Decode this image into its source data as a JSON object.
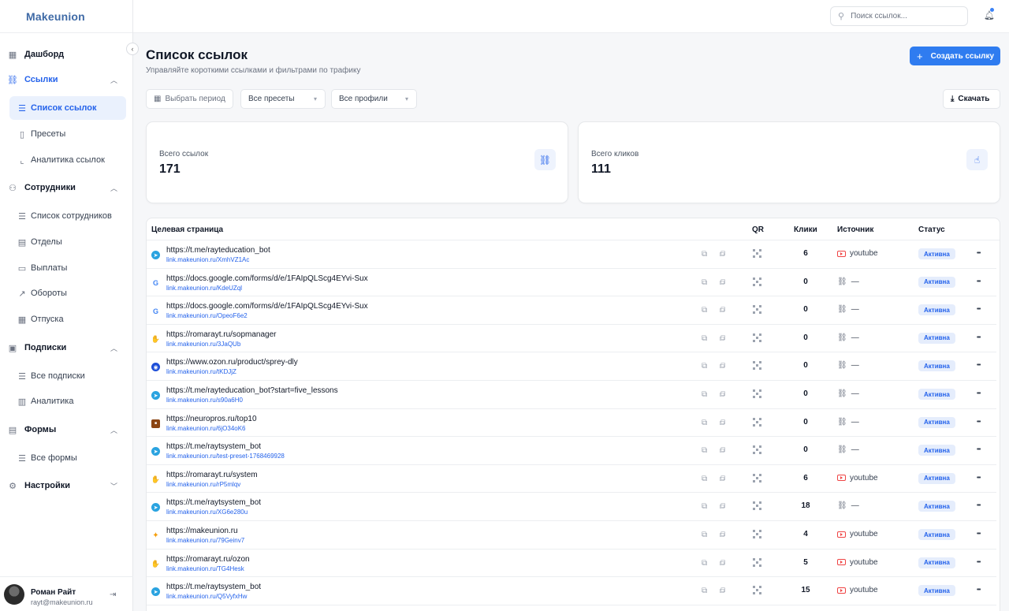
{
  "app": {
    "logo": "Makeunion"
  },
  "sidebar": {
    "items": [
      {
        "label": "Дашборд",
        "icon": "grid-icon",
        "type": "group"
      },
      {
        "label": "Ссылки",
        "icon": "link-icon",
        "type": "group",
        "active": true,
        "expanded": true
      },
      {
        "label": "Список ссылок",
        "icon": "list-icon",
        "type": "sub",
        "selected": true
      },
      {
        "label": "Пресеты",
        "icon": "bookmark-icon",
        "type": "sub"
      },
      {
        "label": "Аналитика ссылок",
        "icon": "chart-icon",
        "type": "sub"
      },
      {
        "label": "Сотрудники",
        "icon": "users-icon",
        "type": "group",
        "expanded": true
      },
      {
        "label": "Список сотрудников",
        "icon": "list-icon",
        "type": "sub"
      },
      {
        "label": "Отделы",
        "icon": "building-icon",
        "type": "sub"
      },
      {
        "label": "Выплаты",
        "icon": "card-icon",
        "type": "sub"
      },
      {
        "label": "Обороты",
        "icon": "trend-icon",
        "type": "sub"
      },
      {
        "label": "Отпуска",
        "icon": "calendar-icon",
        "type": "sub"
      },
      {
        "label": "Подписки",
        "icon": "wallet-icon",
        "type": "group",
        "expanded": true
      },
      {
        "label": "Все подписки",
        "icon": "list-icon",
        "type": "sub"
      },
      {
        "label": "Аналитика",
        "icon": "bar-chart-icon",
        "type": "sub"
      },
      {
        "label": "Формы",
        "icon": "doc-icon",
        "type": "group",
        "expanded": true
      },
      {
        "label": "Все формы",
        "icon": "list-icon",
        "type": "sub"
      },
      {
        "label": "Настройки",
        "icon": "gear-icon",
        "type": "group",
        "expanded": false
      }
    ],
    "user": {
      "name": "Роман Райт",
      "email": "rayt@makeunion.ru"
    }
  },
  "topbar": {
    "search_placeholder": "Поиск ссылок..."
  },
  "main": {
    "title": "Список ссылок",
    "subtitle": "Управляйте короткими ссылками и фильтрами по трафику",
    "create_label": "Создать ссылку",
    "filters": {
      "period": "Выбрать период",
      "presets": "Все пресеты",
      "profiles": "Все профили"
    },
    "download_label": "Скачать",
    "stats": [
      {
        "label": "Всего ссылок",
        "value": "171",
        "icon": "link-icon"
      },
      {
        "label": "Всего кликов",
        "value": "111",
        "icon": "click-icon"
      }
    ],
    "table": {
      "headers": {
        "target": "Целевая страница",
        "qr": "QR",
        "clicks": "Клики",
        "source": "Источник",
        "status": "Статус"
      },
      "rows": [
        {
          "fav": "telegram",
          "url": "https://t.me/rayteducation_bot",
          "short": "link.makeunion.ru/XmhVZ1Ac",
          "clicks": "6",
          "source": "youtube",
          "status": "Активна"
        },
        {
          "fav": "google",
          "url": "https://docs.google.com/forms/d/e/1FAIpQLScg4EYvi-Sux",
          "short": "link.makeunion.ru/KdeUZql",
          "clicks": "0",
          "source": "—",
          "status": "Активна"
        },
        {
          "fav": "google",
          "url": "https://docs.google.com/forms/d/e/1FAIpQLScg4EYvi-Sux",
          "short": "link.makeunion.ru/OpeoF6e2",
          "clicks": "0",
          "source": "—",
          "status": "Активна"
        },
        {
          "fav": "hand",
          "url": "https://romarayt.ru/sopmanager",
          "short": "link.makeunion.ru/3JaQUb",
          "clicks": "0",
          "source": "—",
          "status": "Активна"
        },
        {
          "fav": "ozon",
          "url": "https://www.ozon.ru/product/sprey-dly",
          "short": "link.makeunion.ru/tKDJjZ",
          "clicks": "0",
          "source": "—",
          "status": "Активна"
        },
        {
          "fav": "telegram",
          "url": "https://t.me/rayteducation_bot?start=five_lessons",
          "short": "link.makeunion.ru/s90a6H0",
          "clicks": "0",
          "source": "—",
          "status": "Активна"
        },
        {
          "fav": "neuro",
          "url": "https://neuropros.ru/top10",
          "short": "link.makeunion.ru/6jO34oK6",
          "clicks": "0",
          "source": "—",
          "status": "Активна"
        },
        {
          "fav": "telegram",
          "url": "https://t.me/raytsystem_bot",
          "short": "link.makeunion.ru/test-preset-1768469928",
          "clicks": "0",
          "source": "—",
          "status": "Активна"
        },
        {
          "fav": "hand",
          "url": "https://romarayt.ru/system",
          "short": "link.makeunion.ru/rP5mlqv",
          "clicks": "6",
          "source": "youtube",
          "status": "Активна"
        },
        {
          "fav": "telegram",
          "url": "https://t.me/raytsystem_bot",
          "short": "link.makeunion.ru/XG6e280u",
          "clicks": "18",
          "source": "—",
          "status": "Активна"
        },
        {
          "fav": "sparkle",
          "url": "https://makeunion.ru",
          "short": "link.makeunion.ru/79Geinv7",
          "clicks": "4",
          "source": "youtube",
          "status": "Активна"
        },
        {
          "fav": "hand",
          "url": "https://romarayt.ru/ozon",
          "short": "link.makeunion.ru/TG4Hesk",
          "clicks": "5",
          "source": "youtube",
          "status": "Активна"
        },
        {
          "fav": "telegram",
          "url": "https://t.me/raytsystem_bot",
          "short": "link.makeunion.ru/Q5VyfxHw",
          "clicks": "15",
          "source": "youtube",
          "status": "Активна"
        }
      ]
    }
  },
  "colors": {
    "accent": "#2f7cf0",
    "link": "#2563eb",
    "status_bg": "#e5edfc",
    "youtube": "#ef4444"
  }
}
